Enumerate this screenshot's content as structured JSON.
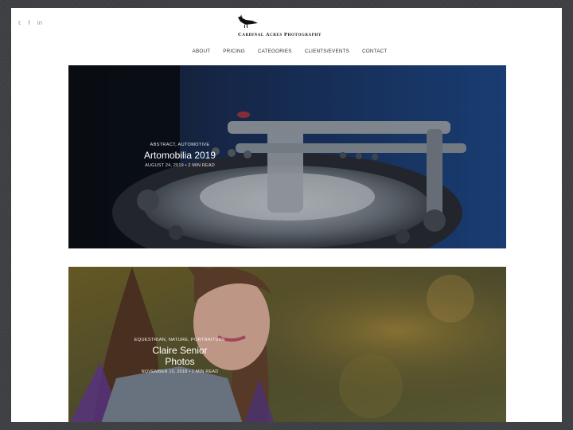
{
  "social": {
    "twitter_icon": "twitter-icon",
    "facebook_icon": "facebook-icon",
    "linkedin_icon": "linkedin-icon",
    "twitter_glyph": "𝕥",
    "facebook_glyph": "f",
    "linkedin_glyph": "in"
  },
  "brand": {
    "name": "Cardinal Acres Photography"
  },
  "nav": [
    {
      "label": "ABOUT"
    },
    {
      "label": "PRICING"
    },
    {
      "label": "CATEGORIES"
    },
    {
      "label": "CLIENTS/EVENTS"
    },
    {
      "label": "CONTACT"
    }
  ],
  "posts": [
    {
      "categories": "ABSTRACT, AUTOMOTIVE",
      "title": "Artomobilia 2019",
      "meta": "AUGUST 24, 2019 • 2 MIN READ"
    },
    {
      "categories": "EQUESTRIAN, NATURE, PORTRAITURE",
      "title": "Claire Senior Photos",
      "meta": "NOVEMBER 10, 2018 • 1 MIN READ"
    }
  ]
}
